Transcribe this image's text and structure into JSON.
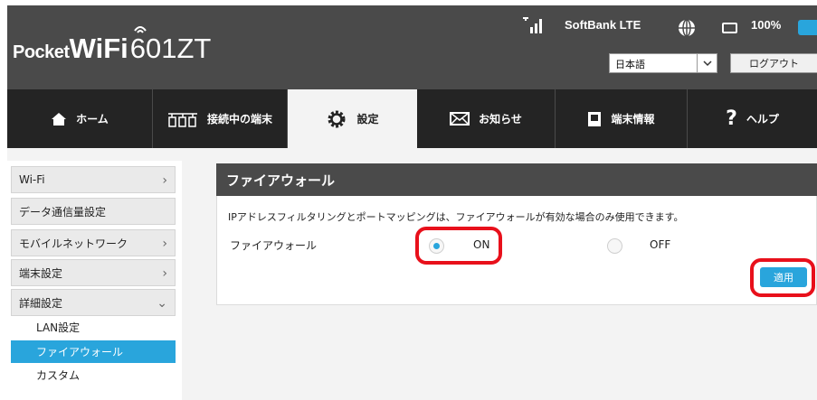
{
  "header": {
    "brand_pocket": "Pocket",
    "brand_wifi": "WiFi",
    "brand_model": "601ZT",
    "carrier": "SoftBank  LTE",
    "battery": "100%",
    "language": "日本語",
    "logout": "ログアウト",
    "accent_color": "#29a5dc"
  },
  "nav": {
    "items": [
      {
        "label": "ホーム",
        "icon": "home-icon"
      },
      {
        "label": "接続中の端末",
        "icon": "devices-icon"
      },
      {
        "label": "設定",
        "icon": "gear-icon"
      },
      {
        "label": "お知らせ",
        "icon": "mail-icon"
      },
      {
        "label": "端末情報",
        "icon": "device-info-icon"
      },
      {
        "label": "ヘルプ",
        "icon": "help-icon"
      }
    ],
    "active": "設定"
  },
  "sidebar": {
    "items": [
      {
        "label": "Wi-Fi"
      },
      {
        "label": "データ通信量設定"
      },
      {
        "label": "モバイルネットワーク"
      },
      {
        "label": "端末設定"
      },
      {
        "label": "詳細設定"
      }
    ],
    "subitems": [
      {
        "label": "LAN設定"
      },
      {
        "label": "ファイアウォール",
        "active": true
      },
      {
        "label": "カスタム"
      }
    ]
  },
  "main": {
    "title": "ファイアウォール",
    "description": "IPアドレスフィルタリングとポートマッピングは、ファイアウォールが有効な場合のみ使用できます。",
    "field_label": "ファイアウォール",
    "option_on": "ON",
    "option_off": "OFF",
    "selected": "ON",
    "apply": "適用",
    "highlight_color": "#e8101b"
  }
}
